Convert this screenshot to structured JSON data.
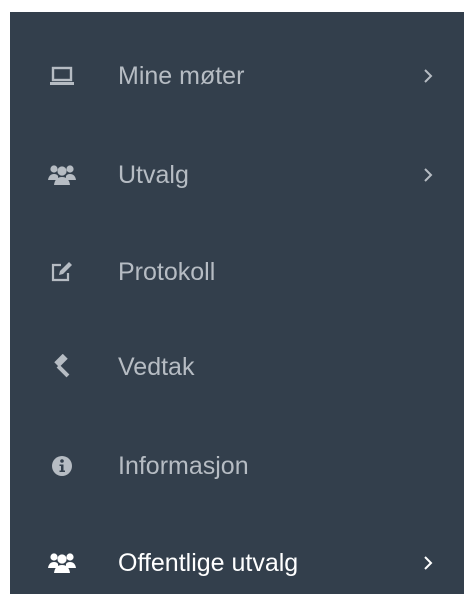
{
  "colors": {
    "sidebar_bg": "#333f4c",
    "label": "#b6bcc3",
    "label_active": "#ffffff"
  },
  "menu": {
    "items": [
      {
        "label": "Mine møter",
        "icon": "laptop-icon",
        "has_submenu": true,
        "active": false
      },
      {
        "label": "Utvalg",
        "icon": "users-icon",
        "has_submenu": true,
        "active": false
      },
      {
        "label": "Protokoll",
        "icon": "edit-icon",
        "has_submenu": false,
        "active": false
      },
      {
        "label": "Vedtak",
        "icon": "gavel-icon",
        "has_submenu": false,
        "active": false
      },
      {
        "label": "Informasjon",
        "icon": "info-icon",
        "has_submenu": false,
        "active": false
      },
      {
        "label": "Offentlige utvalg",
        "icon": "users-icon",
        "has_submenu": true,
        "active": true
      }
    ]
  }
}
